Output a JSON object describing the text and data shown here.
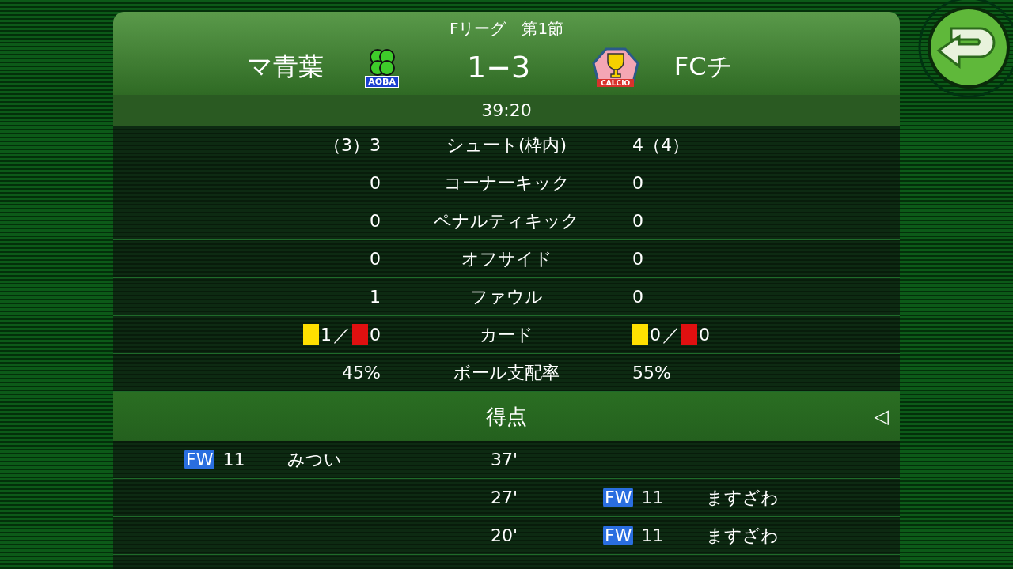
{
  "header": {
    "league": "Fリーグ　第1節",
    "home": {
      "name": "マ青葉",
      "logo_label": "AOBA"
    },
    "score": "1−3",
    "away": {
      "name": "FCチ",
      "logo_label": "CALCIO"
    }
  },
  "clock": "39:20",
  "stats": [
    {
      "kind": "value",
      "label": "シュート(枠内)",
      "home": "（3）3",
      "away": "4（4）"
    },
    {
      "kind": "value",
      "label": "コーナーキック",
      "home": "0",
      "away": "0"
    },
    {
      "kind": "value",
      "label": "ペナルティキック",
      "home": "0",
      "away": "0"
    },
    {
      "kind": "value",
      "label": "オフサイド",
      "home": "0",
      "away": "0"
    },
    {
      "kind": "value",
      "label": "ファウル",
      "home": "1",
      "away": "0"
    },
    {
      "kind": "cards",
      "label": "カード",
      "home_cards": {
        "yellow": "1",
        "sep": "／",
        "red": "0"
      },
      "away_cards": {
        "yellow": "0",
        "sep": "／",
        "red": "0"
      }
    },
    {
      "kind": "value",
      "label": "ボール支配率",
      "home": "45%",
      "away": "55%"
    }
  ],
  "goals_section": {
    "title": "得点",
    "toggle": "◁"
  },
  "goals": [
    {
      "kind": "home",
      "minute": "37'",
      "position": "FW",
      "number": "11",
      "player": "みつい"
    },
    {
      "kind": "away",
      "minute": "27'",
      "position": "FW",
      "number": "11",
      "player": "ますざわ"
    },
    {
      "kind": "away",
      "minute": "20'",
      "position": "FW",
      "number": "11",
      "player": "ますざわ"
    }
  ]
}
